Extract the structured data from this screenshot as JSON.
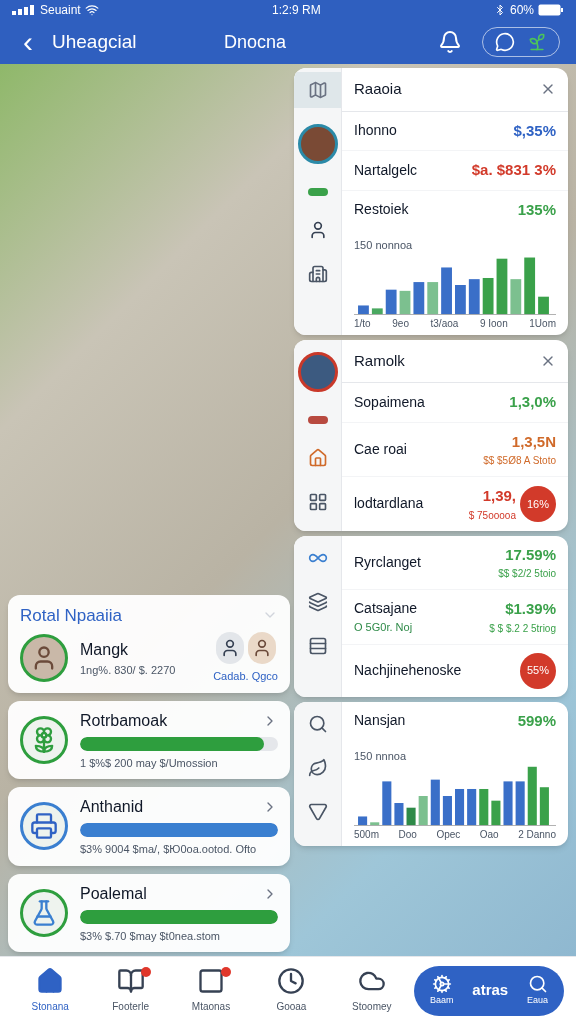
{
  "status_bar": {
    "carrier": "Seuaint",
    "time": "1:2:9 RM",
    "battery": "60%"
  },
  "header": {
    "back": "‹",
    "title": "Uheagcial",
    "subtitle": "Dnocna"
  },
  "left_panel": {
    "title": "Rotal Npaaiia",
    "featured": {
      "name": "Mangk",
      "detail": "1ng%. 830/ $. 2270",
      "people_caption": "Cadab. Qgco"
    },
    "cards": [
      {
        "name": "Rotrbamoak",
        "detail": "1 $%$ 200 may $/Umossion",
        "level": 0.93,
        "color": "#2e9e3e"
      },
      {
        "name": "Anthanid",
        "detail": "$3% 9004 $ma/, $Ю0oa.ootod. Ofto",
        "level": 1,
        "color": "#3a7fd0"
      },
      {
        "name": "Poalemal",
        "detail": "$3% $.70 $may $t0nea.stom",
        "level": 1,
        "color": "#2e9e3e"
      }
    ]
  },
  "panels": [
    {
      "title": "Raaoia",
      "rail": [
        {
          "selected": true
        },
        {
          "selected": false
        },
        {
          "selected": false
        },
        {
          "selected": false
        },
        {
          "selected": false
        }
      ],
      "rows": [
        {
          "label": "Ihonno",
          "value": "$,35%",
          "color": "#2f62c4"
        },
        {
          "label": "Nartalgelc",
          "value": "$a. $831 3%",
          "color": "#d23a2a"
        },
        {
          "label": "Restoiek",
          "value": "135%",
          "color": "#3aa14a"
        }
      ],
      "chart": {
        "tick": "150 nonnoa",
        "xlabels": [
          "1/to",
          "9eo",
          "t3/aoa",
          "9 Ioon",
          "1Uom"
        ]
      }
    },
    {
      "title": "Ramolk",
      "rail": [
        {
          "selected": false
        },
        {
          "selected": false
        },
        {
          "selected": false
        },
        {
          "selected": false
        }
      ],
      "rows": [
        {
          "label": "Sopaimena",
          "value": "1,3,0%",
          "color": "#3aa14a"
        },
        {
          "label": "Cae roai",
          "value": "1,3,5N",
          "color": "#d06a2a",
          "sub": "$$ $5Ø8 A Stoto"
        },
        {
          "label": "lodtardlana",
          "value": "1,39,",
          "color": "#d23a2a",
          "sub": "$ 75ooooa",
          "badge": "16%"
        }
      ]
    },
    {
      "rail": [
        {
          "selected": false
        },
        {
          "selected": false
        },
        {
          "selected": false
        }
      ],
      "rows": [
        {
          "label": "Ryrclanget",
          "value": "17.59%",
          "color": "#3aa14a",
          "sub": "$$ $2/2 5toio"
        },
        {
          "label": "Catsajane",
          "value": "$1.39%",
          "color": "#3aa14a",
          "label_sub": "O 5G0r. Noj",
          "sub": "$ $ $.2 2 5triog"
        },
        {
          "label": "Nachjinehenoske",
          "badge": "55%"
        }
      ]
    },
    {
      "rail": [
        {
          "selected": false
        },
        {
          "selected": false
        },
        {
          "selected": false
        }
      ],
      "rows": [
        {
          "label": "Nansjan",
          "value": "599%",
          "color": "#3aa14a"
        }
      ],
      "chart": {
        "tick": "150 nnnoa",
        "xlabels": [
          "500m",
          "Doo",
          "Opec",
          "Oao",
          "2 Danno"
        ]
      }
    }
  ],
  "nav": {
    "items": [
      {
        "label": "Stonana",
        "selected": true,
        "badge": false
      },
      {
        "label": "Footerle",
        "selected": false,
        "badge": true
      },
      {
        "label": "Mtaonas",
        "selected": false,
        "badge": true
      },
      {
        "label": "Gooaa",
        "selected": false,
        "badge": false
      },
      {
        "label": "Stoomey",
        "selected": false,
        "badge": false
      }
    ],
    "action": {
      "title": "atras",
      "left_caption": "Baam",
      "right_caption": "Eaua"
    }
  }
}
